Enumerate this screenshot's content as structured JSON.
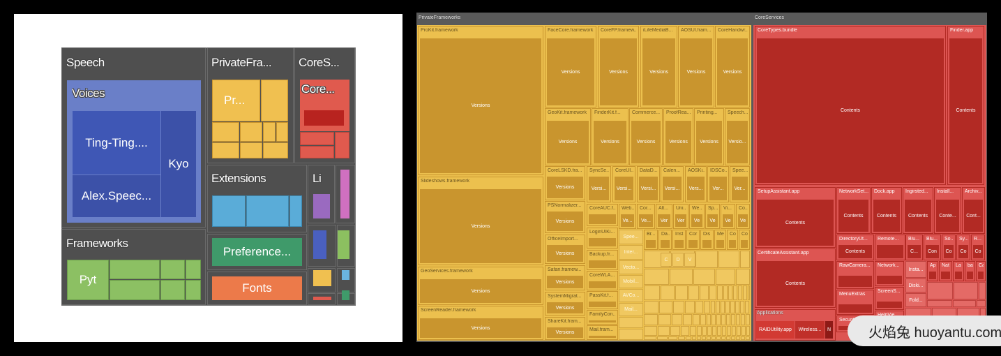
{
  "colors": {
    "speech_outer": "#6a7fc8",
    "speech_leaf": "#3f57b5",
    "speech_leaf_dark": "#3c51a8",
    "frameworks": "#8cc063",
    "private": "#f0c050",
    "core": "#e05a4e",
    "core_dark": "#b8231f",
    "extensions": "#5aacd8",
    "preference": "#3f9a6a",
    "fonts": "#ec7a4a",
    "li": "#9a6ac0",
    "pink": "#d070c0",
    "group_bg": "#4f4f4f",
    "pf_light": "#ecc04e",
    "pf_dark": "#c9952e",
    "cs_light": "#dd5552",
    "cs_dark": "#b22a24"
  },
  "chart_data": [
    {
      "type": "treemap",
      "nodes": {
        "speech": "Speech",
        "voices": "Voices",
        "ting": "Ting-Ting....",
        "alex": "Alex.Speec...",
        "kyo": "Kyo",
        "frameworks": "Frameworks",
        "pyt": "Pyt",
        "private": "PrivateFra...",
        "private_child": "Pr...",
        "cores": "CoreS...",
        "cores_child": "Core...",
        "extensions": "Extensions",
        "li": "Li",
        "preference": "Preference...",
        "fonts": "Fonts"
      }
    },
    {
      "type": "treemap",
      "private_frameworks": {
        "title": "PrivateFrameworks",
        "nodes": [
          {
            "label": "ProKit.framework",
            "child": "Versions"
          },
          {
            "label": "FaceCore.framework",
            "child": "Versions"
          },
          {
            "label": "CoreFP.framew...",
            "child": "Versions"
          },
          {
            "label": "iLifeMediaB...",
            "child": "Versions"
          },
          {
            "label": "AOSUI.fram...",
            "child": "Versions"
          },
          {
            "label": "CoreHandwr...",
            "child": "Versions"
          },
          {
            "label": "GeoKit.framework",
            "child": "Versions"
          },
          {
            "label": "FinderKit.f...",
            "child": "Versions"
          },
          {
            "label": "Commerce...",
            "child": "Versions"
          },
          {
            "label": "ProofRea...",
            "child": "Versions"
          },
          {
            "label": "Printing...",
            "child": "Versions"
          },
          {
            "label": "Speech...",
            "child": "Versio..."
          },
          {
            "label": "CoreLSKD.fra...",
            "child": "Versions"
          },
          {
            "label": "SyncSe...",
            "child": "Versi..."
          },
          {
            "label": "CoreUI...",
            "child": "Versi..."
          },
          {
            "label": "DataD...",
            "child": "Versi..."
          },
          {
            "label": "Calen...",
            "child": "Versi..."
          },
          {
            "label": "AOSKi...",
            "child": "Vers..."
          },
          {
            "label": "IDSCo...",
            "child": "Ver..."
          },
          {
            "label": "Spee...",
            "child": "Ver..."
          },
          {
            "label": "Slideshows.framework",
            "child": "Versions"
          },
          {
            "label": "GeoServices.framework",
            "child": "Versions"
          },
          {
            "label": "ScreenReader.framework",
            "child": "Versions"
          },
          {
            "label": "PSNormalizer...",
            "child": "Versions"
          },
          {
            "label": "OfficeImport...",
            "child": "Versions"
          },
          {
            "label": "Safari.framew...",
            "child": "Versions"
          },
          {
            "label": "SystemMigrat...",
            "child": "Versions"
          },
          {
            "label": "ShareKit.fram...",
            "child": "Versions"
          },
          {
            "label": "CoreAUC.f...",
            "child": ""
          },
          {
            "label": "LoginUIKi...",
            "child": ""
          },
          {
            "label": "Backup.fr...",
            "child": ""
          },
          {
            "label": "CoreWLA...",
            "child": ""
          },
          {
            "label": "PassKit.f...",
            "child": ""
          },
          {
            "label": "FamilyCon...",
            "child": ""
          },
          {
            "label": "Mail.fram...",
            "child": ""
          },
          {
            "label": "Web...",
            "child": "Ve..."
          },
          {
            "label": "Cor...",
            "child": "Ve..."
          },
          {
            "label": "Alt...",
            "child": "Ver"
          },
          {
            "label": "Uni...",
            "child": "Ver"
          },
          {
            "label": "We...",
            "child": "Ve"
          },
          {
            "label": "Sp...",
            "child": "Ve"
          },
          {
            "label": "Vi...",
            "child": "Ve"
          },
          {
            "label": "Co...",
            "child": "Ve"
          },
          {
            "label": "Br...",
            "child": ""
          },
          {
            "label": "Da...",
            "child": ""
          },
          {
            "label": "Inst",
            "child": ""
          },
          {
            "label": "Cor",
            "child": ""
          },
          {
            "label": "Dis",
            "child": ""
          },
          {
            "label": "Me",
            "child": ""
          },
          {
            "label": "Co",
            "child": ""
          },
          {
            "label": "Co",
            "child": ""
          }
        ],
        "column_tiles": [
          "Spee...",
          "Inter...",
          "Vecto...",
          "Mobil...",
          "AVCo...",
          "Mail..."
        ],
        "grid_letters": [
          "C",
          "D",
          "V"
        ]
      },
      "core_services": {
        "title": "CoreServices",
        "nodes": [
          {
            "label": "CoreTypes.bundle",
            "child": "Contents"
          },
          {
            "label": "Finder.app",
            "child": "Contents"
          },
          {
            "label": "SetupAssistant.app",
            "child": "Contents"
          },
          {
            "label": "CertificateAssistant.app",
            "child": "Contents"
          },
          {
            "label": "NetworkSet...",
            "child": "Contents"
          },
          {
            "label": "Dock.app",
            "child": "Contents"
          },
          {
            "label": "Ingirsted...",
            "child": "Contents"
          },
          {
            "label": "Install...",
            "child": "Conte..."
          },
          {
            "label": "Archiv...",
            "child": "Cont..."
          },
          {
            "label": "DirectoryUt...",
            "child": "Contents"
          },
          {
            "label": "Remote...",
            "child": ""
          },
          {
            "label": "Blu...",
            "child": "C..."
          },
          {
            "label": "Blu...",
            "child": "Con"
          },
          {
            "label": "So...",
            "child": "Co"
          },
          {
            "label": "Sy...",
            "child": "Co"
          },
          {
            "label": "R...",
            "child": "Co"
          },
          {
            "label": "RawCamera...",
            "child": ""
          },
          {
            "label": "Network...",
            "child": ""
          },
          {
            "label": "MenuExtras",
            "child": ""
          },
          {
            "label": "ScreenS...",
            "child": ""
          },
          {
            "label": "SecurityAgen...",
            "child": ""
          },
          {
            "label": "HelpVie...",
            "child": ""
          },
          {
            "label": "Ap",
            "child": ""
          },
          {
            "label": "Nat",
            "child": ""
          },
          {
            "label": "La",
            "child": ""
          },
          {
            "label": "ba",
            "child": ""
          },
          {
            "label": "Ca",
            "child": ""
          }
        ],
        "applications": {
          "label": "Applications",
          "children": [
            "RAIDUtility.app",
            "Wireless...",
            "N"
          ]
        },
        "light_tiles": [
          "Insta...",
          "Diski...",
          "Fold..."
        ]
      }
    }
  ],
  "watermark": "火焰兔 huoyantu.com"
}
